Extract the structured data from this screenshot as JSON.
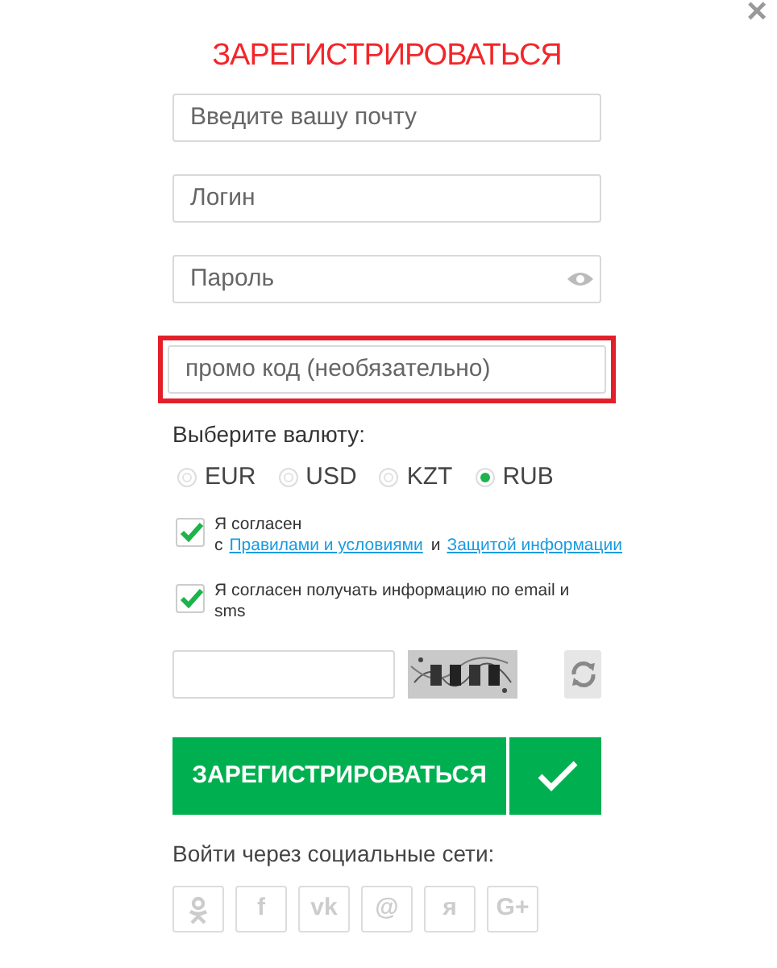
{
  "close": "×",
  "title": "ЗАРЕГИСТРИРОВАТЬСЯ",
  "fields": [
    {
      "placeholder": "Введите вашу почту",
      "kind": "text",
      "highlighted": false
    },
    {
      "placeholder": "Логин",
      "kind": "text",
      "highlighted": false
    },
    {
      "placeholder": "Пароль",
      "kind": "password",
      "highlighted": false
    },
    {
      "placeholder": "промо код (необязательно)",
      "kind": "text",
      "highlighted": true
    }
  ],
  "currency": {
    "label": "Выберите валюту:",
    "options": [
      {
        "label": "EUR",
        "selected": false
      },
      {
        "label": "USD",
        "selected": false
      },
      {
        "label": "KZT",
        "selected": false
      },
      {
        "label": "RUB",
        "selected": true
      }
    ]
  },
  "agreements": [
    {
      "checked": true,
      "parts": [
        {
          "kind": "text",
          "text": "Я согласен с"
        },
        {
          "kind": "link",
          "text": "Правилами и условиями"
        },
        {
          "kind": "text",
          "text": "и"
        },
        {
          "kind": "link",
          "text": "Защитой информации"
        }
      ]
    },
    {
      "checked": true,
      "parts": [
        {
          "kind": "text",
          "text": "Я согласен получать информацию по email и sms"
        }
      ]
    }
  ],
  "submit": "ЗАРЕГИСТРИРОВАТЬСЯ",
  "social": {
    "label": "Войти через социальные сети:",
    "items": [
      {
        "kind": "ok"
      },
      {
        "kind": "text",
        "label": "f"
      },
      {
        "kind": "text",
        "label": "vk"
      },
      {
        "kind": "text",
        "label": "@"
      },
      {
        "kind": "text",
        "label": "я"
      },
      {
        "kind": "text",
        "label": "G+"
      }
    ]
  }
}
